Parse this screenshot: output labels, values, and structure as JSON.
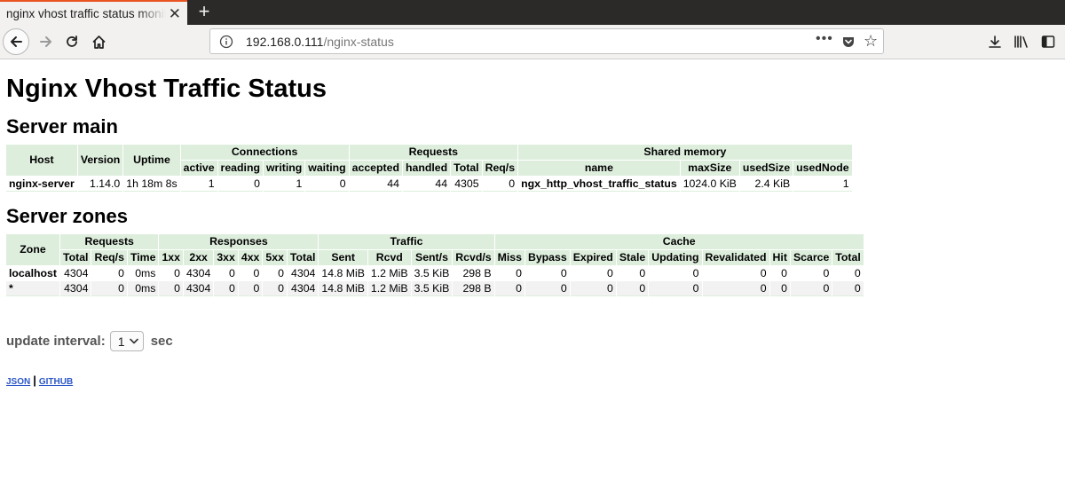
{
  "browser": {
    "tab_title": "nginx vhost traffic status monitor",
    "url_host": "192.168.0.111",
    "url_path": "/nginx-status"
  },
  "page": {
    "title": "Nginx Vhost Traffic Status"
  },
  "server_main": {
    "heading": "Server main",
    "group_headers": {
      "host": "Host",
      "version": "Version",
      "uptime": "Uptime",
      "connections": "Connections",
      "requests": "Requests",
      "shared_memory": "Shared memory"
    },
    "sub_headers": [
      "active",
      "reading",
      "writing",
      "waiting",
      "accepted",
      "handled",
      "Total",
      "Req/s",
      "name",
      "maxSize",
      "usedSize",
      "usedNode"
    ],
    "row": [
      "nginx-server",
      "1.14.0",
      "1h 18m 8s",
      "1",
      "0",
      "1",
      "0",
      "44",
      "44",
      "4305",
      "0",
      "ngx_http_vhost_traffic_status",
      "1024.0 KiB",
      "2.4 KiB",
      "1"
    ]
  },
  "server_zones": {
    "heading": "Server zones",
    "group_headers": {
      "zone": "Zone",
      "requests": "Requests",
      "responses": "Responses",
      "traffic": "Traffic",
      "cache": "Cache"
    },
    "sub_headers": [
      "Total",
      "Req/s",
      "Time",
      "1xx",
      "2xx",
      "3xx",
      "4xx",
      "5xx",
      "Total",
      "Sent",
      "Rcvd",
      "Sent/s",
      "Rcvd/s",
      "Miss",
      "Bypass",
      "Expired",
      "Stale",
      "Updating",
      "Revalidated",
      "Hit",
      "Scarce",
      "Total"
    ],
    "rows": [
      [
        "localhost",
        "4304",
        "0",
        "0ms",
        "0",
        "4304",
        "0",
        "0",
        "0",
        "4304",
        "14.8 MiB",
        "1.2 MiB",
        "3.5 KiB",
        "298 B",
        "0",
        "0",
        "0",
        "0",
        "0",
        "0",
        "0",
        "0",
        "0"
      ],
      [
        "*",
        "4304",
        "0",
        "0ms",
        "0",
        "4304",
        "0",
        "0",
        "0",
        "4304",
        "14.8 MiB",
        "1.2 MiB",
        "3.5 KiB",
        "298 B",
        "0",
        "0",
        "0",
        "0",
        "0",
        "0",
        "0",
        "0",
        "0"
      ]
    ]
  },
  "update_interval": {
    "label": "update interval:",
    "value": "1",
    "unit": "sec"
  },
  "links": {
    "json": "JSON",
    "separator": "|",
    "github": "GITHUB"
  },
  "colors": {
    "header_bg": "#deeedd",
    "even_row_bg": "#f2f2f2",
    "link": "#2a56c6",
    "tab_accent": "#e95420"
  }
}
